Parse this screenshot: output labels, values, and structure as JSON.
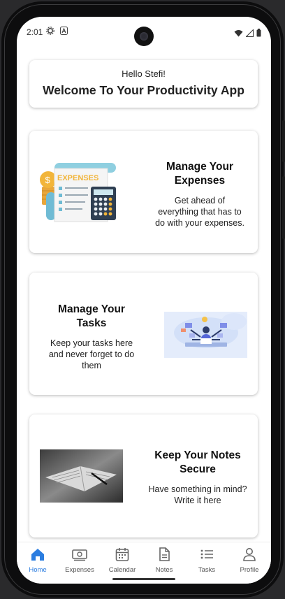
{
  "status_bar": {
    "time": "2:01"
  },
  "welcome": {
    "greeting": "Hello Stefi!",
    "title": "Welcome To Your Productivity App"
  },
  "features": {
    "expenses": {
      "heading": "Manage Your Expenses",
      "description": "Get ahead of everything that has to do with your expenses.",
      "illustration_label": "EXPENSES"
    },
    "tasks": {
      "heading": "Manage Your Tasks",
      "description": "Keep your tasks here and never forget to do them"
    },
    "notes": {
      "heading": "Keep Your Notes Secure",
      "description": "Have something in mind? Write it here"
    }
  },
  "bottom_nav": {
    "active": "Home",
    "items": [
      {
        "label": "Home",
        "icon": "home-icon"
      },
      {
        "label": "Expenses",
        "icon": "money-icon"
      },
      {
        "label": "Calendar",
        "icon": "calendar-icon"
      },
      {
        "label": "Notes",
        "icon": "document-icon"
      },
      {
        "label": "Tasks",
        "icon": "list-icon"
      },
      {
        "label": "Profile",
        "icon": "person-icon"
      }
    ]
  },
  "colors": {
    "accent": "#2b7de0",
    "text": "#111111",
    "card_bg": "#ffffff"
  }
}
